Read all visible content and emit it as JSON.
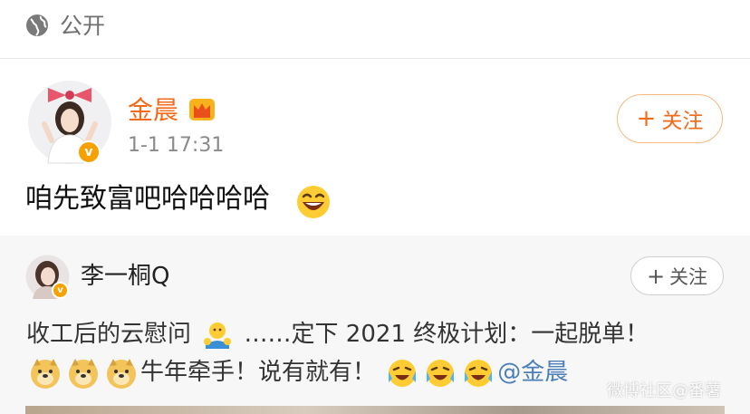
{
  "visibility": {
    "icon": "globe-icon",
    "label": "公开"
  },
  "post": {
    "author": "金晨",
    "author_color": "#f26a1a",
    "verified_badge": "v",
    "time": "1-1 17:31",
    "follow_label": "关注",
    "text": "咱先致富吧哈哈哈哈",
    "emoji": "laugh-emoji"
  },
  "repost": {
    "author": "李一桐Q",
    "verified_badge": "v",
    "follow_label": "关注",
    "line1_a": "收工后的云慰问",
    "line1_b": "……定下 2021 终极计划：一起脱单！",
    "line2_text": "牛年牵手！说有就有！",
    "mention": "@金晨",
    "watermark": "微博社区@番薯"
  },
  "colors": {
    "accent": "#f26a1a",
    "link": "#4a7fb8",
    "badge": "#f6a100"
  }
}
